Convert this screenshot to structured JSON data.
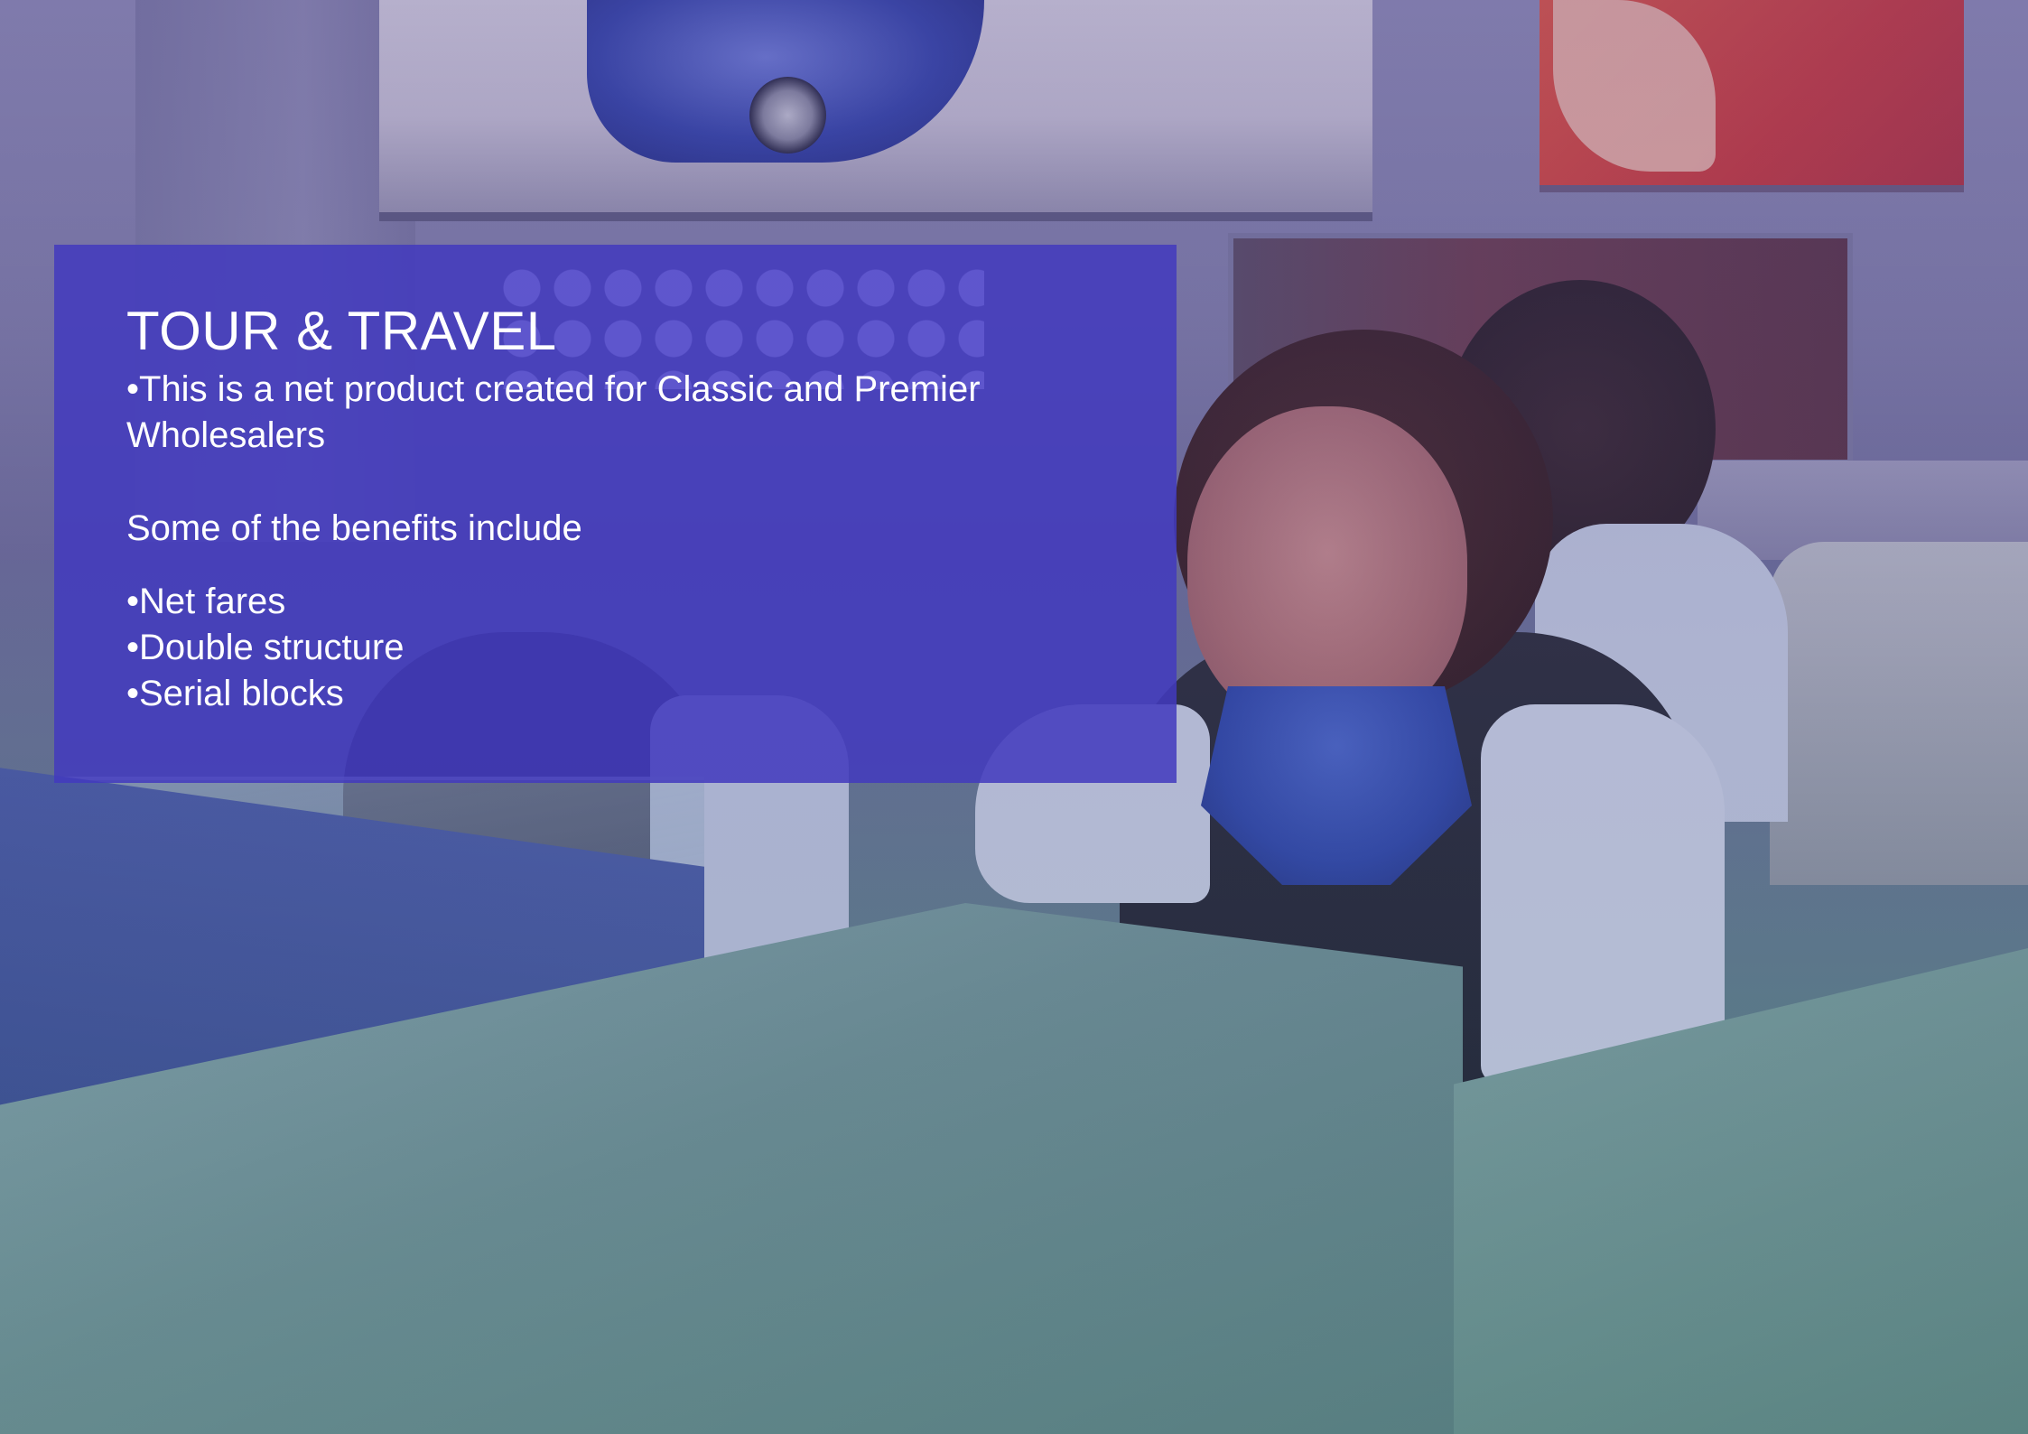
{
  "slide": {
    "title": "TOUR & TRAVEL",
    "intro": "•This is a net product created for Classic and Premier Wholesalers",
    "benefits_heading": "Some of the benefits include",
    "benefits": [
      "•Net fares",
      "•Double structure",
      "•Serial blocks"
    ]
  },
  "colors": {
    "panel_background": "#423abe",
    "text": "#ffffff",
    "photo_tint": "#6e6b9a"
  }
}
